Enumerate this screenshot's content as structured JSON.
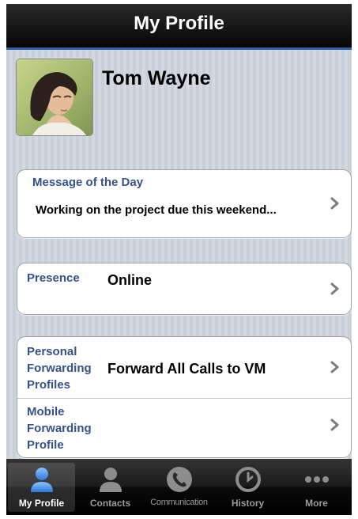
{
  "header": {
    "title": "My Profile"
  },
  "profile": {
    "name": "Tom Wayne"
  },
  "message": {
    "label": "Message of the Day",
    "value": "Working on the project due this weekend..."
  },
  "presence": {
    "label": "Presence",
    "value": "Online"
  },
  "forwarding": {
    "personal": {
      "label": [
        "Personal",
        "Forwarding",
        "Profiles"
      ],
      "value": "Forward All Calls to VM"
    },
    "mobile": {
      "label": [
        "Mobile",
        "Forwarding",
        "Profile"
      ],
      "value": ""
    }
  },
  "tabbar": {
    "selected": "My Profile",
    "items": [
      {
        "label": "My Profile",
        "icon": "person-icon"
      },
      {
        "label": "Contacts",
        "icon": "contacts-icon"
      },
      {
        "label": "Communication",
        "icon": "phone-icon"
      },
      {
        "label": "History",
        "icon": "clock-icon"
      },
      {
        "label": "More",
        "icon": "more-dots-icon"
      }
    ]
  },
  "colors": {
    "accent_label": "#35528f",
    "nav_bar": "#000000",
    "tab_selected": "#4a90e2"
  }
}
